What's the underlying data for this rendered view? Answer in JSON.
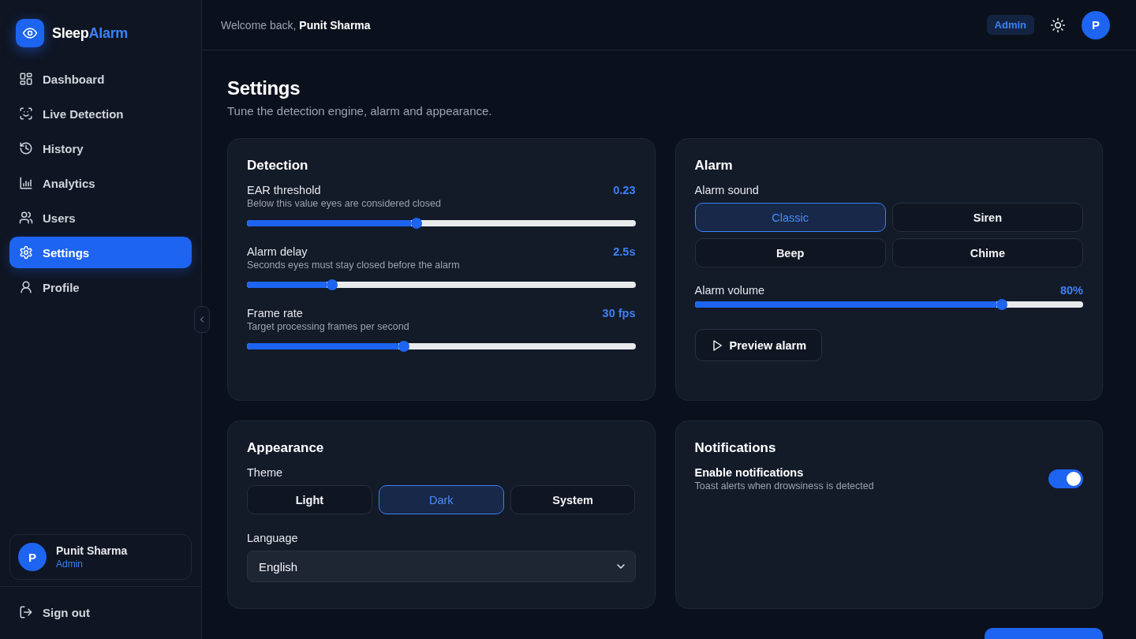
{
  "brand": {
    "name_start": "Sleep",
    "name_end": "Alarm"
  },
  "sidebar": {
    "items": [
      {
        "label": "Dashboard",
        "selected": false
      },
      {
        "label": "Live Detection",
        "selected": false
      },
      {
        "label": "History",
        "selected": false
      },
      {
        "label": "Analytics",
        "selected": false
      },
      {
        "label": "Users",
        "selected": false
      },
      {
        "label": "Settings",
        "selected": true
      },
      {
        "label": "Profile",
        "selected": false
      }
    ],
    "user": {
      "avatar": "P",
      "name": "Punit Sharma",
      "role": "Admin"
    },
    "sign_out": "Sign out"
  },
  "header": {
    "greeting": "Welcome back, **Punit Sharma**",
    "role_badge": "Admin",
    "avatar": "P"
  },
  "page": {
    "title": "Settings",
    "subtitle": "Tune the detection engine, alarm and appearance."
  },
  "detection": {
    "title": "Detection",
    "sliders": [
      {
        "label": "EAR threshold",
        "hint": "Below this value eyes are considered closed",
        "reading": "0.23",
        "level": 0.436
      },
      {
        "label": "Alarm delay",
        "hint": "Seconds eyes must stay closed before the alarm",
        "reading": "2.5s",
        "level": 0.219
      },
      {
        "label": "Frame rate",
        "hint": "Target processing frames per second",
        "reading": "30 fps",
        "level": 0.404
      }
    ]
  },
  "alarm": {
    "title": "Alarm",
    "sound_label": "Alarm sound",
    "sounds": [
      {
        "label": "Classic",
        "selected": true
      },
      {
        "label": "Siren",
        "selected": false
      },
      {
        "label": "Beep",
        "selected": false
      },
      {
        "label": "Chime",
        "selected": false
      }
    ],
    "volume": {
      "label": "Alarm volume",
      "reading": "80%",
      "level": 0.79
    },
    "preview_button": "Preview alarm"
  },
  "appearance": {
    "title": "Appearance",
    "theme_label": "Theme",
    "themes": [
      {
        "label": "Light",
        "selected": false
      },
      {
        "label": "Dark",
        "selected": true
      },
      {
        "label": "System",
        "selected": false
      }
    ],
    "language_label": "Language",
    "language": "English"
  },
  "notifications": {
    "title": "Notifications",
    "toggles": [
      {
        "label": "Enable notifications",
        "hint": "Toast alerts when drowsiness is detected",
        "on": true
      }
    ]
  }
}
